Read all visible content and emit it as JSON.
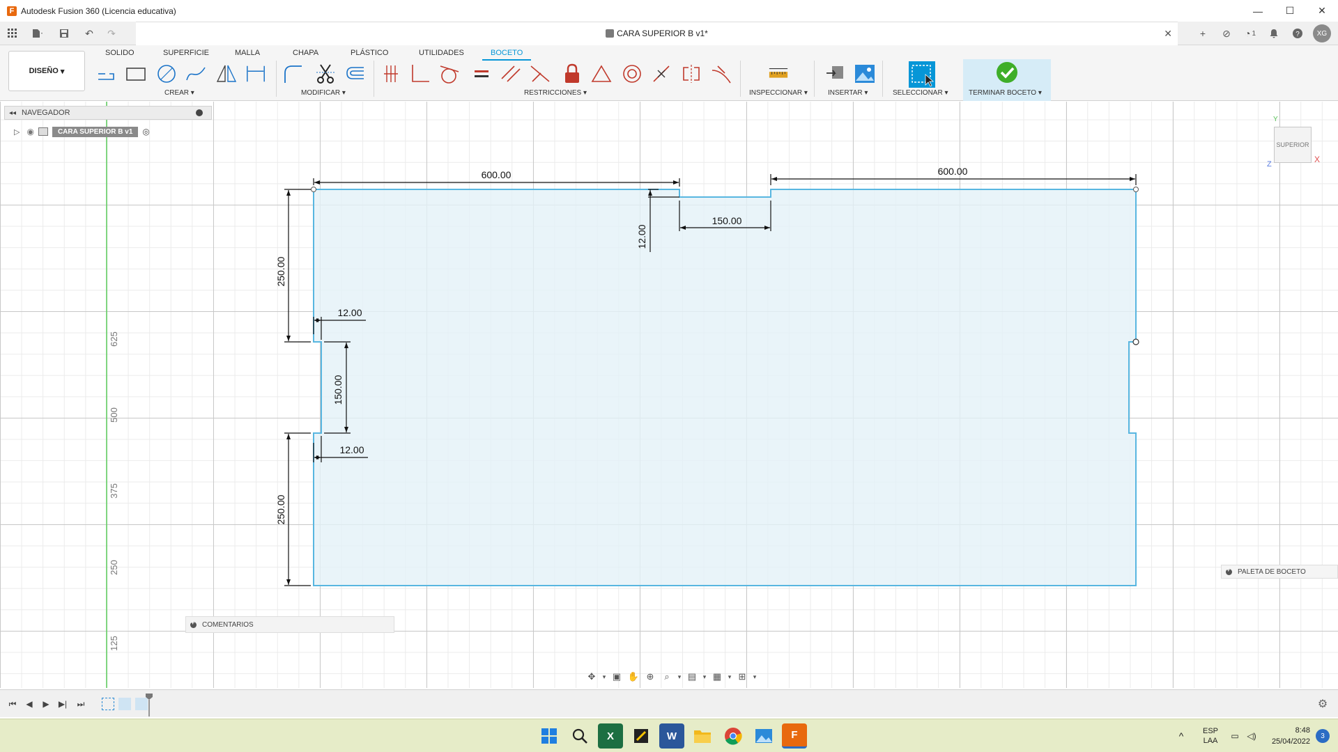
{
  "window": {
    "title": "Autodesk Fusion 360 (Licencia educativa)",
    "minimize": "—",
    "maximize": "☐",
    "close": "✕"
  },
  "document": {
    "tab_title": "CARA SUPERIOR B v1*",
    "close": "✕",
    "jobs_count": "1",
    "user_initials": "XG"
  },
  "ribbon": {
    "workspace": "DISEÑO",
    "tabs": [
      "SOLIDO",
      "SUPERFICIE",
      "MALLA",
      "CHAPA",
      "PLÁSTICO",
      "UTILIDADES",
      "BOCETO"
    ],
    "active_tab": "BOCETO",
    "groups": {
      "create": "CREAR",
      "modify": "MODIFICAR",
      "constraints": "RESTRICCIONES",
      "inspect": "INSPECCIONAR",
      "insert": "INSERTAR",
      "select": "SELECCIONAR",
      "finish": "TERMINAR BOCETO"
    }
  },
  "browser": {
    "header": "NAVEGADOR",
    "component": "CARA SUPERIOR B v1"
  },
  "viewcube": {
    "face": "SUPERIOR",
    "x": "X",
    "y": "Y",
    "z": "Z"
  },
  "palette": "PALETA DE BOCETO",
  "comments": "COMENTARIOS",
  "sketch": {
    "dimensions": {
      "top_left_width": "600.00",
      "top_right_width": "600.00",
      "notch_width_top": "150.00",
      "notch_depth_top": "12.00",
      "left_upper_height": "250.00",
      "left_lower_height": "250.00",
      "notch_height_left": "150.00",
      "notch_depth_left_upper": "12.00",
      "notch_depth_left_lower": "12.00"
    },
    "ruler": [
      "625",
      "500",
      "375",
      "250",
      "125"
    ]
  },
  "taskbar": {
    "lang": "ESP",
    "layout": "LAA",
    "time": "8:48",
    "date": "25/04/2022",
    "notifications": "3"
  }
}
